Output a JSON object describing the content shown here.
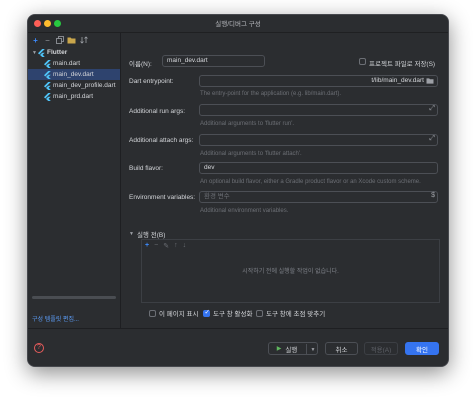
{
  "window": {
    "title": "실행/디버그 구성"
  },
  "sidebar": {
    "toolbar_icons": [
      "add-icon",
      "remove-icon",
      "copy-icon",
      "folder-icon",
      "sort-icon"
    ],
    "group": {
      "label": "Flutter"
    },
    "items": [
      {
        "label": "main.dart"
      },
      {
        "label": "main_dev.dart",
        "selected": true
      },
      {
        "label": "main_dev_profile.dart"
      },
      {
        "label": "main_prd.dart"
      }
    ],
    "template_link": "구성 템플릿 편집..."
  },
  "form": {
    "name_label": "이름(N):",
    "name_value": "main_dev.dart",
    "store_as_project_file_label": "프로젝트 파일로 저장(S)",
    "entrypoint_label": "Dart entrypoint:",
    "entrypoint_value": "t/lib/main_dev.dart",
    "entrypoint_hint": "The entry-point for the application (e.g. lib/main.dart).",
    "run_args_label": "Additional run args:",
    "run_args_value": "",
    "run_args_hint": "Additional arguments to 'flutter run'.",
    "attach_args_label": "Additional attach args:",
    "attach_args_value": "",
    "attach_args_hint": "Additional arguments to 'flutter attach'.",
    "build_flavor_label": "Build flavor:",
    "build_flavor_value": "dev",
    "build_flavor_hint": "An optional build flavor, either a Gradle product flavor or an Xcode custom scheme.",
    "env_label": "Environment variables:",
    "env_placeholder": "환경 변수",
    "env_hint": "Additional environment variables."
  },
  "before_launch": {
    "title": "실행 전(B)",
    "toolbar": [
      "add-icon",
      "remove-icon",
      "edit-icon",
      "up-icon",
      "down-icon"
    ],
    "empty_text": "시작하기 전에 실행할 작업이 없습니다."
  },
  "options": [
    {
      "label": "이 페이지 표시",
      "checked": false
    },
    {
      "label": "도구 창 활성화",
      "checked": true
    },
    {
      "label": "도구 창에 초점 맞추기",
      "checked": false
    }
  ],
  "buttons": {
    "run": "실행",
    "cancel": "취소",
    "apply": "적용(A)",
    "ok": "확인"
  },
  "colors": {
    "accent": "#3574f0",
    "background": "#2b2d30",
    "selection": "#2e436e",
    "link": "#5c9cf5"
  }
}
